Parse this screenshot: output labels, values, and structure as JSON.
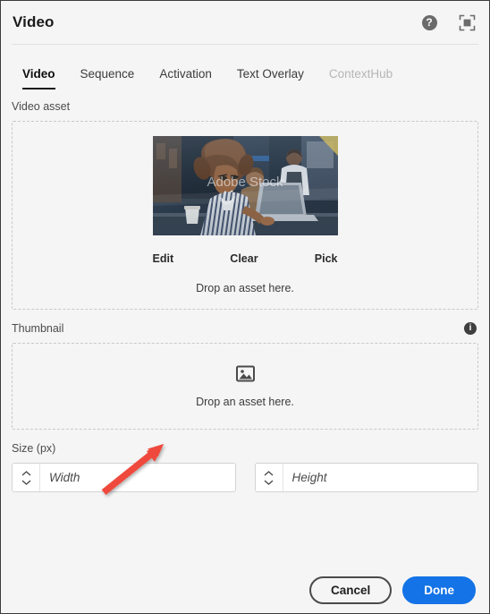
{
  "header": {
    "title": "Video",
    "help_icon": "help-circle-icon",
    "help_glyph": "?",
    "fullscreen_icon": "select-fullscreen-icon"
  },
  "tabs": [
    {
      "label": "Video",
      "state": "active"
    },
    {
      "label": "Sequence",
      "state": "normal"
    },
    {
      "label": "Activation",
      "state": "normal"
    },
    {
      "label": "Text Overlay",
      "state": "normal"
    },
    {
      "label": "ContextHub",
      "state": "disabled"
    }
  ],
  "video_asset": {
    "label": "Video asset",
    "preview_alt": "Woman with curly hair working on a laptop in a cafe, Adobe Stock watermark",
    "watermark": "Adobe Stock",
    "actions": [
      {
        "label": "Edit",
        "name": "edit-asset-button"
      },
      {
        "label": "Clear",
        "name": "clear-asset-button"
      },
      {
        "label": "Pick",
        "name": "pick-asset-button"
      }
    ],
    "drop_hint": "Drop an asset here."
  },
  "thumbnail": {
    "label": "Thumbnail",
    "info_icon": "info-circle-icon",
    "info_glyph": "i",
    "placeholder_icon": "image-icon",
    "drop_hint": "Drop an asset here."
  },
  "size": {
    "label": "Size (px)",
    "width": {
      "value": "",
      "placeholder": "Width"
    },
    "height": {
      "value": "",
      "placeholder": "Height"
    }
  },
  "footer": {
    "cancel_label": "Cancel",
    "done_label": "Done"
  },
  "annotation": {
    "arrow_color": "#ef4a3c",
    "description": "red arrow pointing at thumbnail drop zone"
  },
  "colors": {
    "accent": "#1473e6",
    "background": "#f5f5f5",
    "text": "#1b1b1b",
    "muted": "#b6b6b6",
    "dashed_border": "#c9c9c9"
  }
}
